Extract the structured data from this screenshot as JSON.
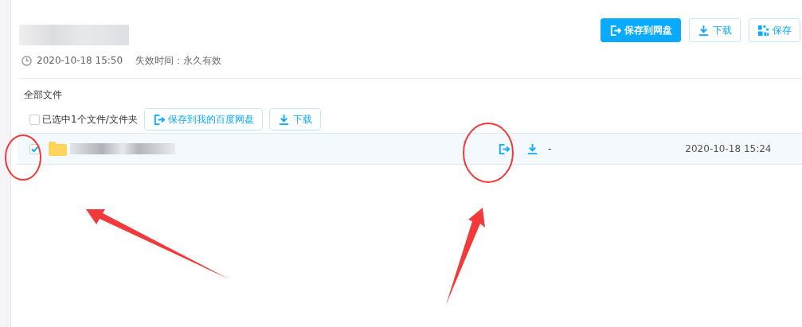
{
  "header_buttons": [
    {
      "label": "保存到网盘",
      "kind": "save",
      "primary": true
    },
    {
      "label": "下载",
      "kind": "download",
      "primary": false
    },
    {
      "label": "保存",
      "kind": "qr",
      "primary": false
    }
  ],
  "meta": {
    "created": "2020-10-18 15:50",
    "expiry": "失效时间：永久有效"
  },
  "breadcrumb": "全部文件",
  "toolbar": {
    "select_label": "已选中1个文件/文件夹",
    "select_all_checked": false,
    "buttons": [
      {
        "label": "保存到我的百度网盘",
        "kind": "save"
      },
      {
        "label": "下载",
        "kind": "download"
      }
    ]
  },
  "files": [
    {
      "selected": true,
      "size": "-",
      "modified": "2020-10-18 15:24"
    }
  ]
}
